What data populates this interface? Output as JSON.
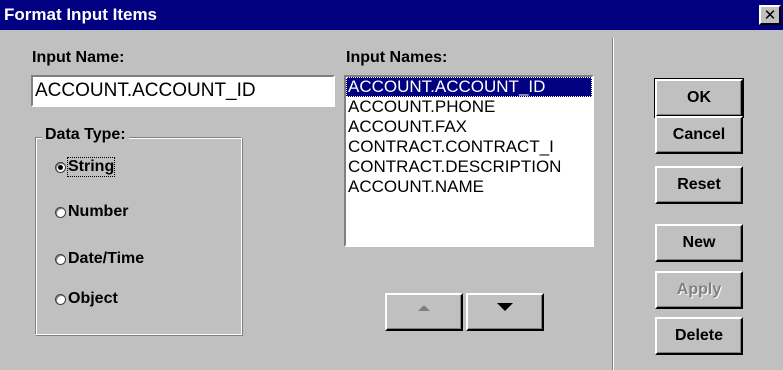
{
  "window": {
    "title": "Format Input Items",
    "close_glyph": "✕"
  },
  "input_name": {
    "label": "Input Name:",
    "value": "ACCOUNT.ACCOUNT_ID"
  },
  "data_type": {
    "label": "Data Type:",
    "options": [
      {
        "label": "String",
        "selected": true
      },
      {
        "label": "Number",
        "selected": false
      },
      {
        "label": "Date/Time",
        "selected": false
      },
      {
        "label": "Object",
        "selected": false
      }
    ]
  },
  "input_names": {
    "label": "Input Names:",
    "items": [
      "ACCOUNT.ACCOUNT_ID",
      "ACCOUNT.PHONE",
      "ACCOUNT.FAX",
      "CONTRACT.CONTRACT_I",
      "CONTRACT.DESCRIPTION",
      "ACCOUNT.NAME"
    ],
    "selected_index": 0
  },
  "move_buttons": {
    "up_icon": "triangle-up",
    "down_icon": "triangle-down"
  },
  "buttons": {
    "ok": "OK",
    "cancel": "Cancel",
    "reset": "Reset",
    "new": "New",
    "apply": "Apply",
    "delete": "Delete"
  },
  "colors": {
    "title_bar": "#000080",
    "face": "#c0c0c0",
    "selection": "#000080",
    "disabled_text": "#808080"
  }
}
